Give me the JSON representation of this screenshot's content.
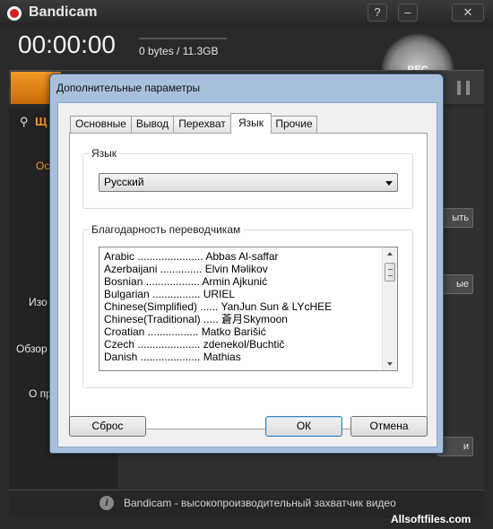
{
  "app": {
    "title": "Bandicam",
    "timer": "00:00:00",
    "storage": "0 bytes / 11.3GB",
    "rec_label": "REC",
    "window_controls": {
      "help": "?",
      "minimize": "–",
      "close": "✕"
    },
    "sidebar": {
      "search_fragment": "Щ",
      "items": [
        "Ос",
        "Изо",
        "Обзор",
        "О пр"
      ]
    },
    "right_buttons": [
      "ыть",
      "ые",
      "и"
    ],
    "status_text": "Bandicam - высокопроизводительный захватчик видео"
  },
  "dialog": {
    "title": "Дополнительные параметры",
    "tabs": [
      {
        "label": "Основные",
        "active": false
      },
      {
        "label": "Вывод",
        "active": false
      },
      {
        "label": "Перехват",
        "active": false
      },
      {
        "label": "Язык",
        "active": true
      },
      {
        "label": "Прочие",
        "active": false
      }
    ],
    "language_group": {
      "label": "Язык",
      "selected": "Русский"
    },
    "translators_group": {
      "label": "Благодарность переводчикам",
      "entries": [
        "Arabic ...................... Abbas Al-saffar",
        "Azerbaijani .............. Elvin Məlikov",
        "Bosnian .................. Armin Ajkunić",
        "Bulgarian ................ URIEL",
        "Chinese(Simplified) ...... YanJun Sun & LYcHEE",
        "Chinese(Traditional) ..... 蒼月Skymoon",
        "Croatian ................. Matko Barišić",
        "Czech ..................... zdenekol/Buchtič",
        "Danish .................... Mathias"
      ]
    },
    "buttons": {
      "reset": "Сброс",
      "ok": "ОК",
      "cancel": "Отмена"
    }
  },
  "watermark": "Allsoftfiles.com"
}
